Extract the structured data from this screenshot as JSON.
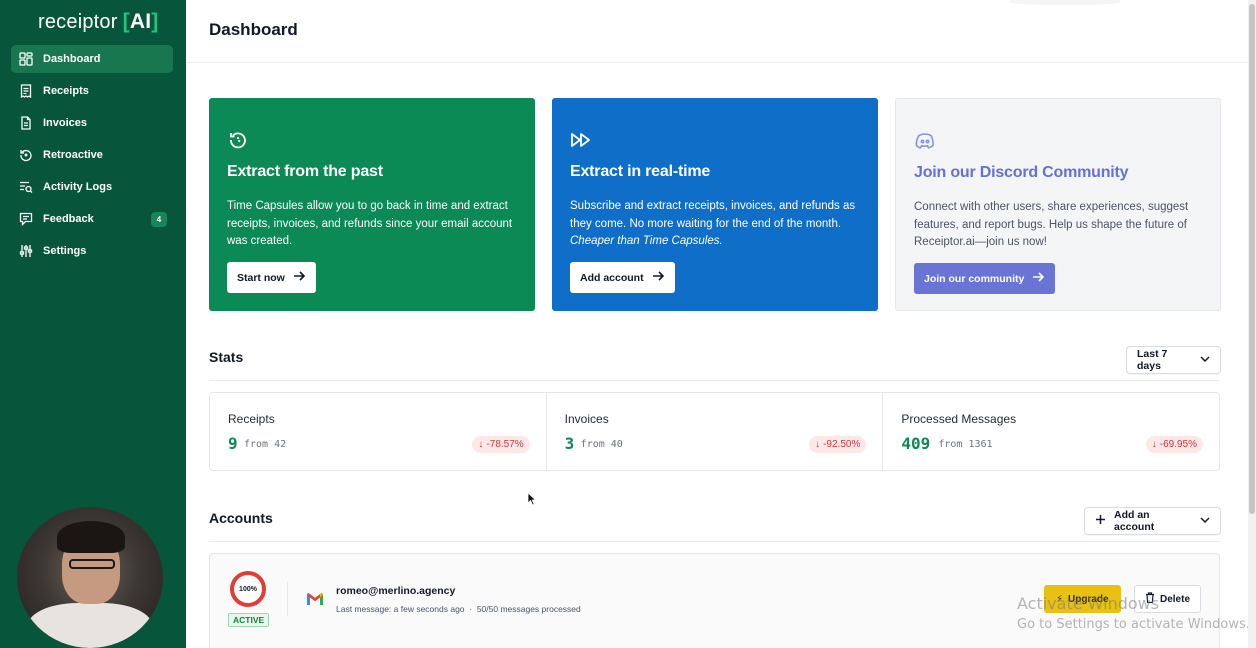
{
  "app": {
    "logo_text": "receiptor",
    "logo_bracket_open": "[",
    "logo_ai": "AI",
    "logo_bracket_close": "]"
  },
  "sidebar": {
    "items": [
      {
        "label": "Dashboard",
        "icon": "dashboard-icon",
        "active": true
      },
      {
        "label": "Receipts",
        "icon": "receipt-icon"
      },
      {
        "label": "Invoices",
        "icon": "invoice-icon"
      },
      {
        "label": "Retroactive",
        "icon": "retroactive-icon"
      },
      {
        "label": "Activity Logs",
        "icon": "activity-logs-icon"
      },
      {
        "label": "Feedback",
        "icon": "feedback-icon",
        "badge": "4"
      },
      {
        "label": "Settings",
        "icon": "settings-icon"
      }
    ]
  },
  "header": {
    "title": "Dashboard"
  },
  "cards": [
    {
      "title": "Extract from the past",
      "text": "Time Capsules allow you to go back in time and extract receipts, invoices, and refunds since your email account was created.",
      "button": "Start now",
      "color": "#0b8a56"
    },
    {
      "title": "Extract in real-time",
      "text": "Subscribe and extract receipts, invoices, and refunds as they come. No more waiting for the end of the month.",
      "text_italic": "Cheaper than Time Capsules.",
      "button": "Add account",
      "color": "#0e6ec8"
    },
    {
      "title": "Join our Discord Community",
      "text": "Connect with other users, share experiences, suggest features, and report bugs. Help us shape the future of Receiptor.ai—join us now!",
      "button": "Join our community",
      "color": "#6974d4"
    }
  ],
  "stats": {
    "title": "Stats",
    "range": "Last 7 days",
    "items": [
      {
        "label": "Receipts",
        "value": "9",
        "from": "from 42",
        "delta": "-78.57%"
      },
      {
        "label": "Invoices",
        "value": "3",
        "from": "from 40",
        "delta": "-92.50%"
      },
      {
        "label": "Processed Messages",
        "value": "409",
        "from": "from 1361",
        "delta": "-69.95%"
      }
    ]
  },
  "accounts": {
    "title": "Accounts",
    "add_button": "Add an account",
    "list": [
      {
        "usage": "100%",
        "status": "ACTIVE",
        "email": "romeo@merlino.agency",
        "last_message": "Last message: a few seconds ago",
        "processed": "50/50 messages processed",
        "upgrade": "Upgrade",
        "delete": "Delete"
      }
    ]
  },
  "watermark": {
    "line1": "Activate Windows",
    "line2": "Go to Settings to activate Windows."
  },
  "colors": {
    "sidebar": "#07553b",
    "accent_green": "#0f8a55",
    "negative": "#d0343a",
    "upgrade": "#e8c112"
  }
}
